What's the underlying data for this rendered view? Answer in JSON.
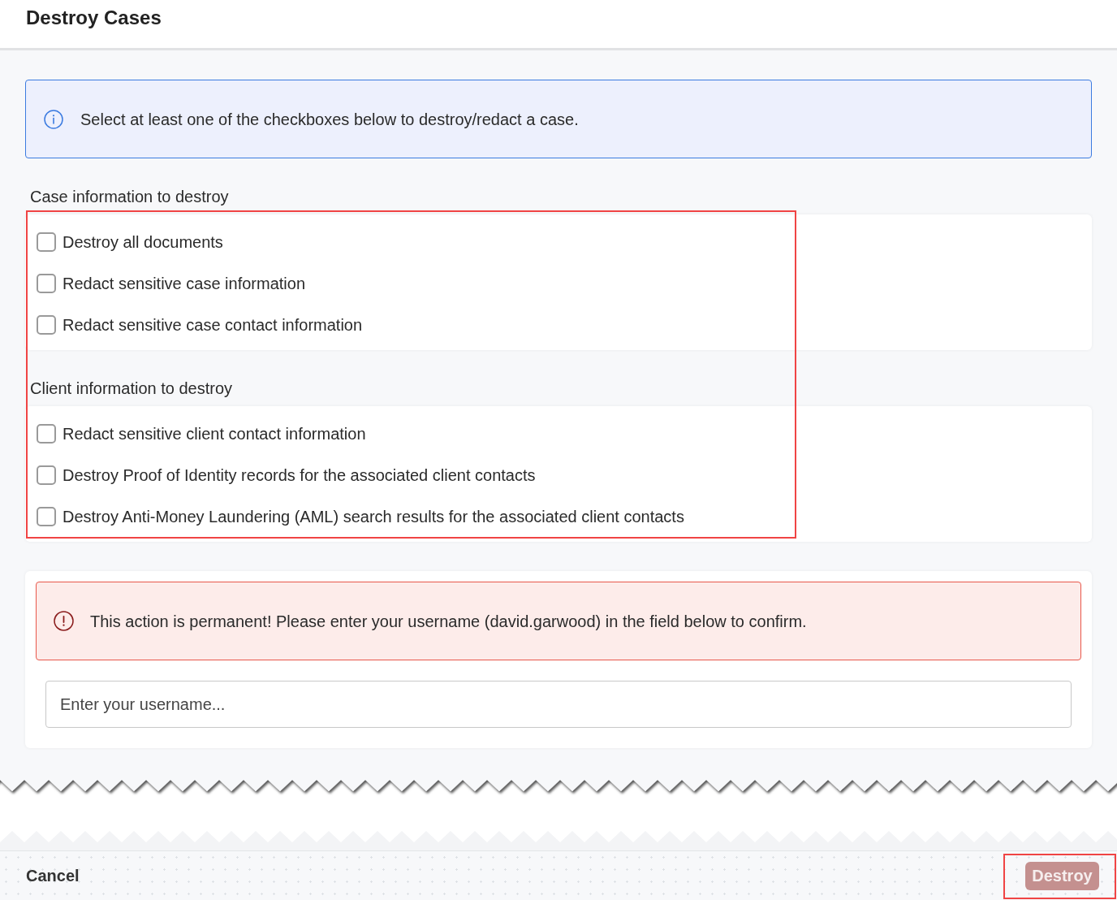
{
  "header": {
    "title": "Destroy Cases"
  },
  "info_banner": {
    "text": "Select at least one of the checkboxes below to destroy/redact a case."
  },
  "options_highlighted": true,
  "sections": [
    {
      "label": "Case information to destroy",
      "options": [
        {
          "label": "Destroy all documents",
          "checked": false
        },
        {
          "label": "Redact sensitive case information",
          "checked": false
        },
        {
          "label": "Redact sensitive case contact information",
          "checked": false
        }
      ]
    },
    {
      "label": "Client information to destroy",
      "options": [
        {
          "label": "Redact sensitive client contact information",
          "checked": false
        },
        {
          "label": "Destroy Proof of Identity records for the associated client contacts",
          "checked": false
        },
        {
          "label": "Destroy Anti-Money Laundering (AML) search results for the associated client contacts",
          "checked": false
        }
      ]
    }
  ],
  "warning_banner": {
    "text": "This action is permanent! Please enter your username (david.garwood) in the field below to confirm."
  },
  "username_field": {
    "placeholder": "Enter your username..."
  },
  "footer": {
    "cancel": {
      "label": "Cancel"
    },
    "destroy": {
      "label": "Destroy",
      "disabled": true,
      "highlighted": true
    }
  }
}
